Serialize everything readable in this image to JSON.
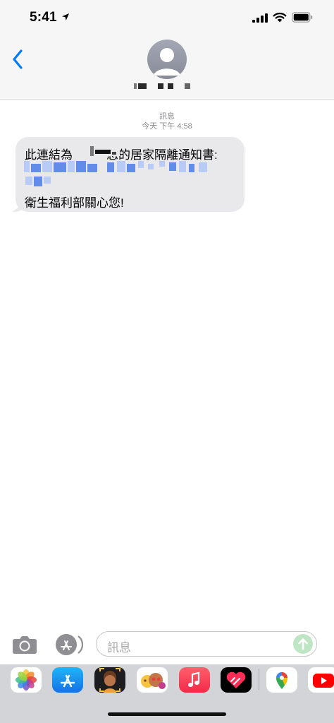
{
  "status_bar": {
    "time": "5:41",
    "icons": [
      "location-arrow-icon",
      "cellular-signal-icon",
      "wifi-icon",
      "battery-icon"
    ]
  },
  "header": {
    "back_icon": "chevron-left-icon",
    "avatar_icon": "person-placeholder-icon",
    "contact_name_redacted": true
  },
  "conversation": {
    "service_label": "訊息",
    "timestamp": "今天 下午 4:58",
    "message": {
      "line1": "此連結為 您的居家隔離通知書:",
      "line3": "衛生福利部關心您!",
      "name_redacted": true,
      "link_redacted": true
    }
  },
  "input_bar": {
    "camera_icon": "camera-icon",
    "apps_icon": "app-store-icon",
    "placeholder": "訊息",
    "send_icon": "send-arrow-icon"
  },
  "app_drawer": {
    "apps": [
      "photos-app-icon",
      "app-store-app-icon",
      "memoji-app-icon",
      "animoji-app-icon",
      "music-app-icon",
      "digital-touch-app-icon",
      "google-maps-app-icon",
      "youtube-app-icon"
    ]
  },
  "colors": {
    "accent": "#007aff",
    "bubble_received": "#e9e9eb",
    "meta_text": "#8a8a8e",
    "send_inactive": "#bfe6c4"
  }
}
